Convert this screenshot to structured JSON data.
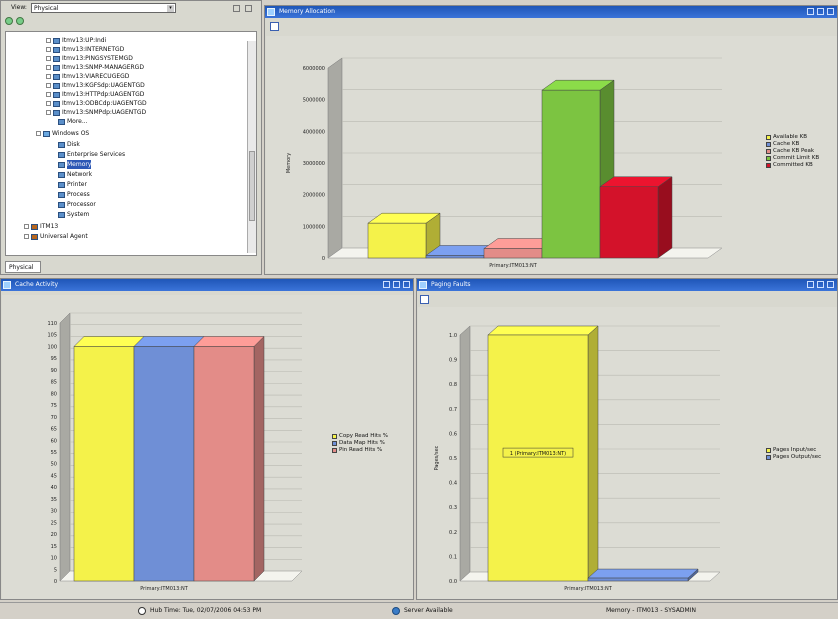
{
  "nav": {
    "view_label": "View:",
    "view_value": "Physical",
    "tab_label": "Physical",
    "tree": [
      "Itmv13:UP:Indi",
      "Itmv13:INTERNETGD",
      "Itmv13:PINGSYSTEMGD",
      "Itmv13:SNMP-MANAGERGD",
      "Itmv13:VIARECUGEGD",
      "Itmv13:KGFSdp:UAGENTGD",
      "Itmv13:HTTPdp:UAGENTGD",
      "Itmv13:ODBCdp:UAGENTGD",
      "Itmv13:SNMPdp:UAGENTGD",
      "More...",
      "Windows OS",
      "Disk",
      "Enterprise Services",
      "Memory",
      "Network",
      "Printer",
      "Process",
      "Processor",
      "System",
      "ITM13",
      "Universal Agent"
    ]
  },
  "panels": {
    "memory": {
      "title": "Memory Allocation"
    },
    "cache": {
      "title": "Cache Activity"
    },
    "paging": {
      "title": "Paging Faults"
    }
  },
  "status": {
    "hub_time": "Hub Time: Tue, 02/07/2006 04:53 PM",
    "server": "Server Available",
    "workspace": "Memory - ITM013 - SYSADMIN"
  },
  "colors": {
    "yellow": "#f4f24a",
    "blue": "#6f8fd6",
    "pink": "#e38c88",
    "green": "#7cc441",
    "red": "#d3122a"
  },
  "chart_data": [
    {
      "type": "bar",
      "categories": [
        "Primary:ITM013:NT"
      ],
      "series": [
        {
          "name": "Available KB",
          "values": [
            1100000
          ]
        },
        {
          "name": "Cache KB",
          "values": [
            80000
          ]
        },
        {
          "name": "Cache KB Peak",
          "values": [
            300000
          ]
        },
        {
          "name": "Commit Limit KB",
          "values": [
            5300000
          ]
        },
        {
          "name": "Committed KB",
          "values": [
            2250000
          ]
        }
      ],
      "ylabel": "Memory",
      "ylim": [
        0,
        6000000
      ],
      "yticks": [
        "0",
        "1000000",
        "2000000",
        "3000000",
        "4000000",
        "5000000",
        "6000000"
      ],
      "grid": true,
      "legend": "right"
    },
    {
      "type": "bar",
      "categories": [
        "Primary:ITM013:NT"
      ],
      "series": [
        {
          "name": "Copy Read Hits %",
          "values": [
            100
          ]
        },
        {
          "name": "Data Map Hits %",
          "values": [
            100
          ]
        },
        {
          "name": "Pin Read Hits %",
          "values": [
            100
          ]
        }
      ],
      "ylim": [
        0,
        110
      ],
      "yticks": [
        "0",
        "5",
        "10",
        "15",
        "20",
        "25",
        "30",
        "35",
        "40",
        "45",
        "50",
        "55",
        "60",
        "65",
        "70",
        "75",
        "80",
        "85",
        "90",
        "95",
        "100",
        "105",
        "110"
      ],
      "grid": true,
      "legend": "right"
    },
    {
      "type": "bar",
      "categories": [
        "Primary:ITM013:NT"
      ],
      "series": [
        {
          "name": "Pages Input/sec",
          "values": [
            1.0
          ]
        },
        {
          "name": "Pages Output/sec",
          "values": [
            0
          ]
        }
      ],
      "ylabel": "Pages/sec",
      "ylim": [
        0,
        1.0
      ],
      "yticks": [
        "0.0",
        "0.1",
        "0.2",
        "0.3",
        "0.4",
        "0.5",
        "0.6",
        "0.7",
        "0.8",
        "0.9",
        "1.0"
      ],
      "annotation": "1 (Primary:ITM013:NT)",
      "grid": true,
      "legend": "right"
    }
  ]
}
